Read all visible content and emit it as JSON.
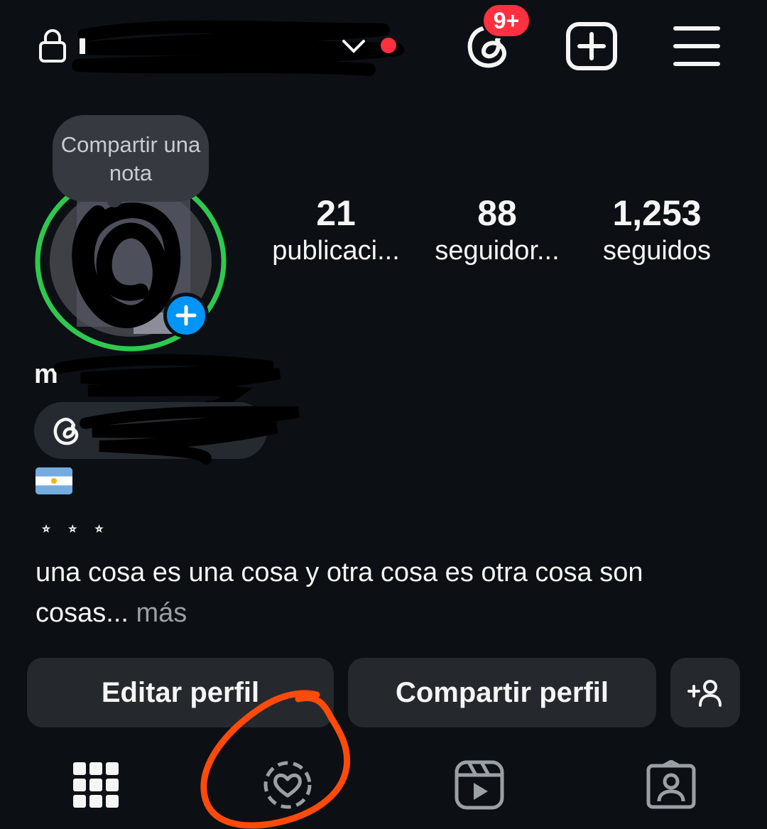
{
  "header": {
    "lock_icon": "lock-icon",
    "username_chevron_icon": "chevron-down-icon",
    "threads_icon": "threads-icon",
    "threads_badge": "9+",
    "new_post_icon": "plus-square-icon",
    "menu_icon": "hamburger-menu-icon",
    "unread_dot_color": "#ff3040"
  },
  "profile": {
    "note_label": "Compartir una nota",
    "avatar_ring_color": "#2fc84f",
    "add_story_icon": "plus-icon",
    "name_initial": "m",
    "threads_chip_icon": "threads-icon",
    "flag": "argentina-flag"
  },
  "stats": [
    {
      "value": "21",
      "label": "publicaci..."
    },
    {
      "value": "88",
      "label": "seguidor..."
    },
    {
      "value": "1,253",
      "label": "seguidos"
    }
  ],
  "bio": {
    "stars": "⭒ ⭒ ⭒",
    "text": "una cosa es una cosa y otra cosa es otra cosa son cosas...",
    "more": "más"
  },
  "actions": {
    "edit": "Editar perfil",
    "share": "Compartir perfil",
    "add_person_icon": "add-person-icon"
  },
  "tabs": [
    {
      "name": "posts",
      "icon": "grid-icon"
    },
    {
      "name": "liked",
      "icon": "heart-circle-icon"
    },
    {
      "name": "reels",
      "icon": "reels-icon"
    },
    {
      "name": "tagged",
      "icon": "tagged-person-icon"
    }
  ],
  "colors": {
    "background": "#0c1014",
    "button": "#25292e",
    "accent_blue": "#0095f6",
    "annotation": "#ff4a0a"
  }
}
